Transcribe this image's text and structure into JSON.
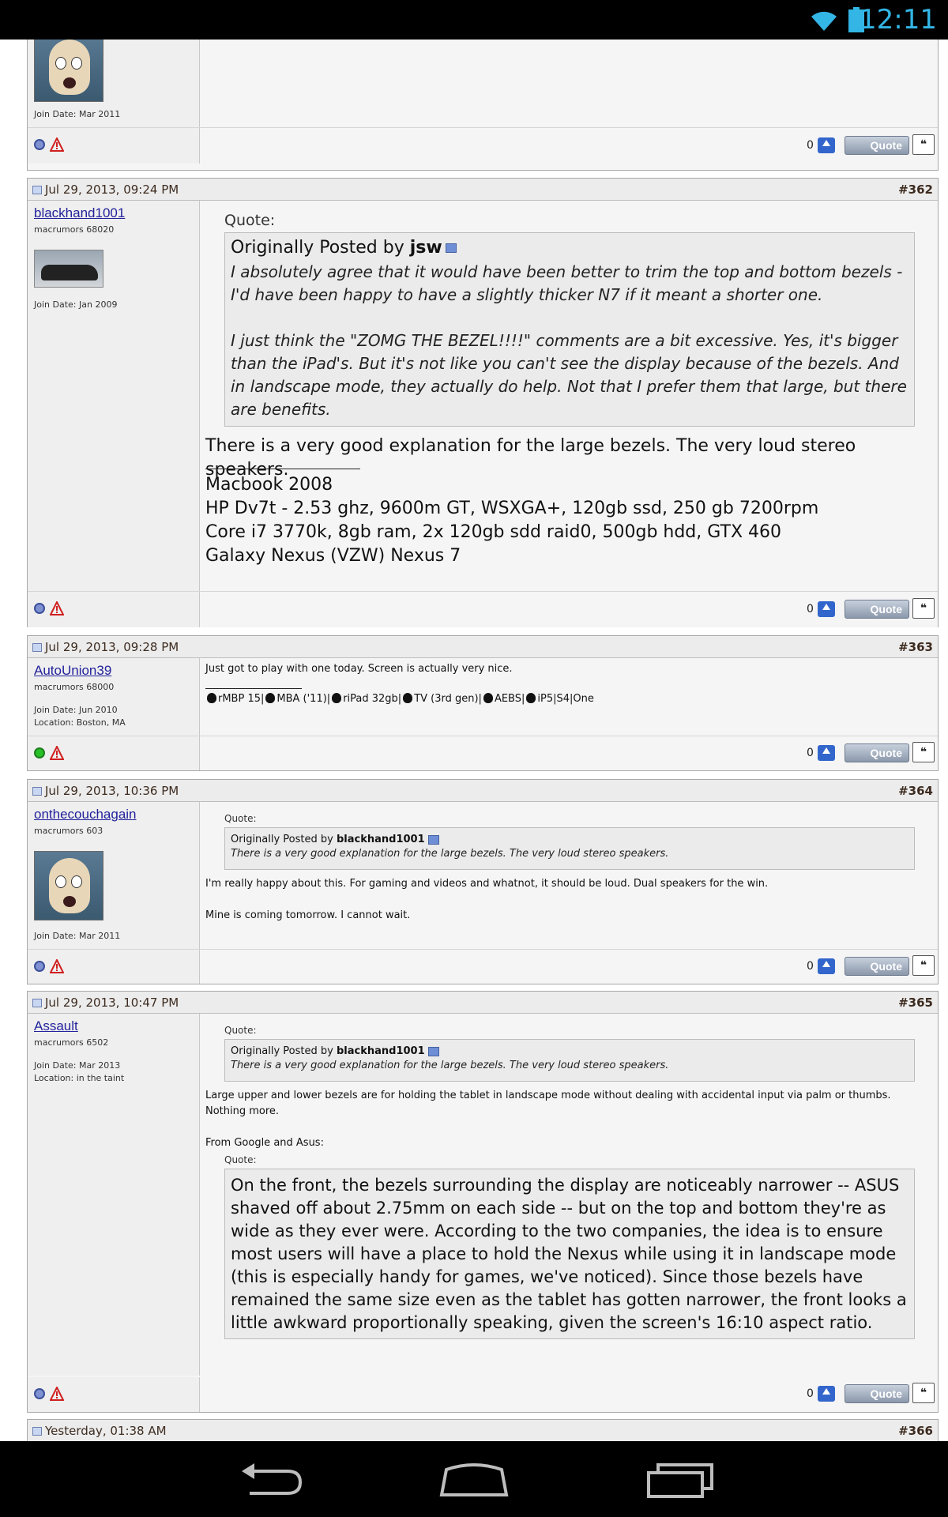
{
  "status_bar": {
    "time": "12:11"
  },
  "posts": {
    "p361": {
      "join": "Join Date: Mar 2011",
      "votes": "0",
      "quote_label": "Quote"
    },
    "p362": {
      "date": "Jul 29, 2013, 09:24 PM",
      "number": "#362",
      "username": "blackhand1001",
      "rank": "macrumors 68020",
      "join": "Join Date: Jan 2009",
      "quote_heading": "Quote:",
      "quote_prefix": "Originally Posted by ",
      "quote_author": "jsw",
      "quote_para1": "I absolutely agree that it would have been better to trim the top and bottom bezels - I'd have been happy to have a slightly thicker N7 if it meant a shorter one.",
      "quote_para2": "I just think the \"ZOMG THE BEZEL!!!!\" comments are a bit excessive. Yes, it's bigger than the iPad's. But it's not like you can't see the display because of the bezels. And in landscape mode, they actually do help. Not that I prefer them that large, but there are benefits.",
      "message": "There is a very good explanation for the large bezels. The very loud stereo speakers.",
      "sig": [
        "Macbook 2008",
        "HP Dv7t - 2.53 ghz, 9600m GT, WSXGA+, 120gb ssd, 250 gb 7200rpm",
        "Core i7 3770k, 8gb ram, 2x 120gb sdd raid0, 500gb hdd, GTX 460",
        "Galaxy Nexus (VZW) Nexus 7"
      ],
      "votes": "0",
      "quote_label": "Quote"
    },
    "p363": {
      "date": "Jul 29, 2013, 09:28 PM",
      "number": "#363",
      "username": "AutoUnion39",
      "rank": "macrumors 68000",
      "join": "Join Date: Jun 2010",
      "location": "Location: Boston, MA",
      "message": "Just got to play with one today. Screen is actually very nice.",
      "sig_items": [
        "rMBP 15|",
        "MBA ('11)|",
        "riPad 32gb|",
        "TV (3rd gen)|",
        "AEBS|",
        "iP5|S4|One"
      ],
      "votes": "0",
      "quote_label": "Quote"
    },
    "p364": {
      "date": "Jul 29, 2013, 10:36 PM",
      "number": "#364",
      "username": "onthecouchagain",
      "rank": "macrumors 603",
      "join": "Join Date: Mar 2011",
      "quote_heading": "Quote:",
      "quote_prefix": "Originally Posted by ",
      "quote_author": "blackhand1001",
      "quote_text": "There is a very good explanation for the large bezels. The very loud stereo speakers.",
      "message1": "I'm really happy about this. For gaming and videos and whatnot, it should be loud. Dual speakers for the win.",
      "message2": "Mine is coming tomorrow. I cannot wait.",
      "votes": "0",
      "quote_label": "Quote"
    },
    "p365": {
      "date": "Jul 29, 2013, 10:47 PM",
      "number": "#365",
      "username": "Assault",
      "rank": "macrumors 6502",
      "join": "Join Date: Mar 2013",
      "location": "Location: in the taint",
      "quote_heading": "Quote:",
      "quote_prefix": "Originally Posted by ",
      "quote_author": "blackhand1001",
      "quote_text": "There is a very good explanation for the large bezels. The very loud stereo speakers.",
      "message1": "Large upper and lower bezels are for holding the tablet in landscape mode without dealing with accidental input via palm or thumbs. Nothing more.",
      "message2": "From Google and Asus:",
      "quote2_heading": "Quote:",
      "quote2_text": "On the front, the bezels surrounding the display are noticeably narrower -- ASUS shaved off about 2.75mm on each side -- but on the top and bottom they're as wide as they ever were. According to the two companies, the idea is to ensure most users will have a place to hold the Nexus while using it in landscape mode (this is especially handy for games, we've noticed). Since those bezels have remained the same size even as the tablet has gotten narrower, the front looks a little awkward proportionally speaking, given the screen's 16:10 aspect ratio.",
      "votes": "0",
      "quote_label": "Quote"
    },
    "p366": {
      "date": "Yesterday, 01:38 AM",
      "number": "#366"
    }
  }
}
